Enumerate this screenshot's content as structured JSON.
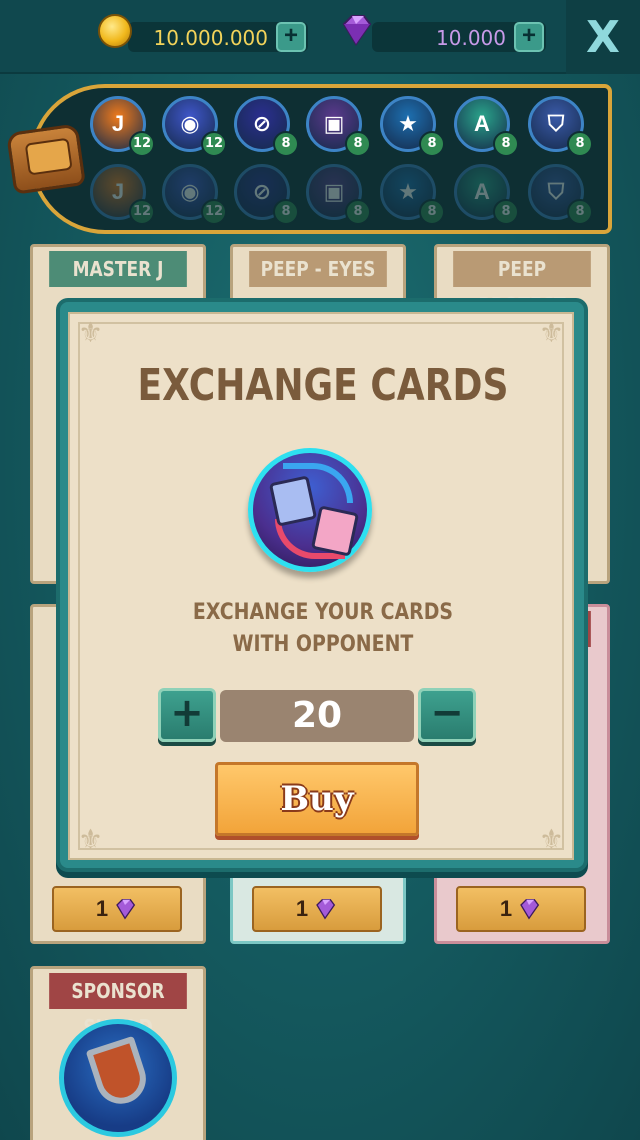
{
  "top": {
    "coins": "10.000.000",
    "gems": "10.000",
    "plus": "+",
    "close": "X"
  },
  "powerups": [
    {
      "icon": "joker-percent-icon",
      "glyph": "J",
      "count": "12",
      "color": "#f07b1c"
    },
    {
      "icon": "eye-icon",
      "glyph": "◉",
      "count": "12",
      "color": "#3f56c9"
    },
    {
      "icon": "no-sign-icon",
      "glyph": "⊘",
      "count": "8",
      "color": "#2b2f8f"
    },
    {
      "icon": "exchange-cards-icon",
      "glyph": "▣",
      "count": "8",
      "color": "#5b3a8c"
    },
    {
      "icon": "star-x2-icon",
      "glyph": "★",
      "count": "8",
      "color": "#1d6fb0"
    },
    {
      "icon": "refresh-a-icon",
      "glyph": "A",
      "count": "8",
      "color": "#2aa38a"
    },
    {
      "icon": "shield-icon",
      "glyph": "⛉",
      "count": "8",
      "color": "#3a5aa8"
    }
  ],
  "cards": [
    {
      "title": "MASTER J",
      "color": "#4d8c76"
    },
    {
      "title": "PEEP - EYES",
      "color": "#b99a74"
    },
    {
      "title": "PEEP PROTECT",
      "color": "#b99a74"
    },
    {
      "title": "SPONSOR SHIELD",
      "color": "#a04545"
    }
  ],
  "card_prices": [
    "1",
    "1",
    "1"
  ],
  "modal": {
    "title": "EXCHANGE CARDS",
    "desc_line1": "EXCHANGE YOUR CARDS",
    "desc_line2": "WITH OPPONENT",
    "quantity": "20",
    "plus": "+",
    "minus": "−",
    "buy": "Buy"
  }
}
